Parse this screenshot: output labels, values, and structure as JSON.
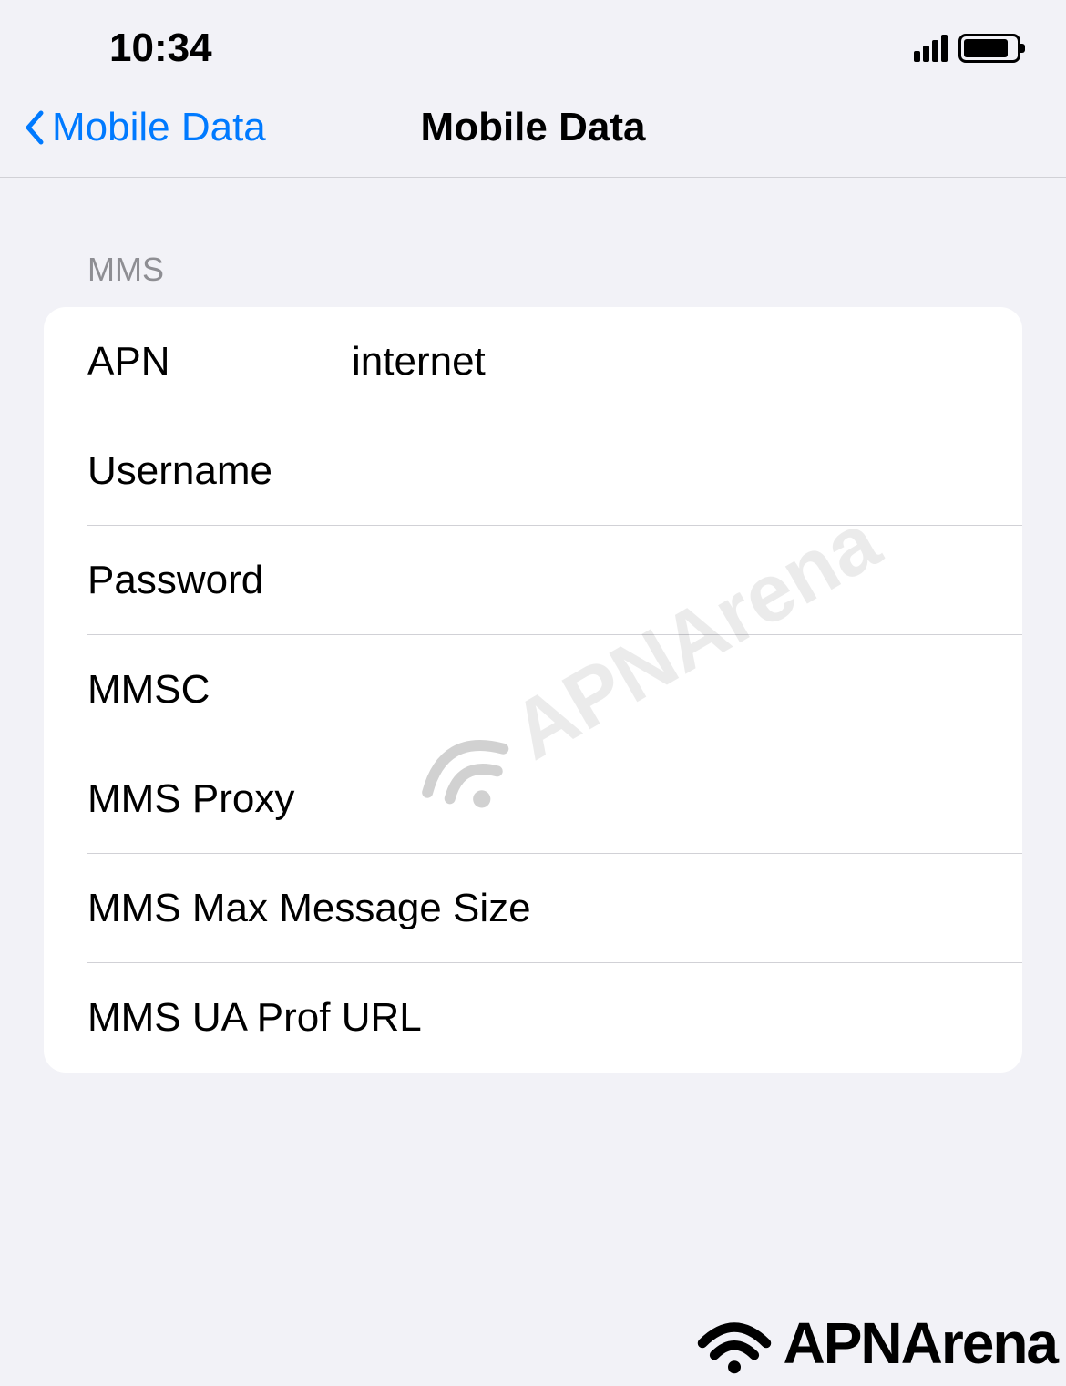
{
  "status_bar": {
    "time": "10:34"
  },
  "nav": {
    "back_label": "Mobile Data",
    "title": "Mobile Data"
  },
  "section_header": "MMS",
  "fields": {
    "apn": {
      "label": "APN",
      "value": "internet"
    },
    "username": {
      "label": "Username",
      "value": ""
    },
    "password": {
      "label": "Password",
      "value": ""
    },
    "mmsc": {
      "label": "MMSC",
      "value": ""
    },
    "mms_proxy": {
      "label": "MMS Proxy",
      "value": ""
    },
    "mms_max_size": {
      "label": "MMS Max Message Size",
      "value": ""
    },
    "mms_ua_prof": {
      "label": "MMS UA Prof URL",
      "value": ""
    }
  },
  "watermark": "APNArena",
  "footer_logo": "APNArena"
}
